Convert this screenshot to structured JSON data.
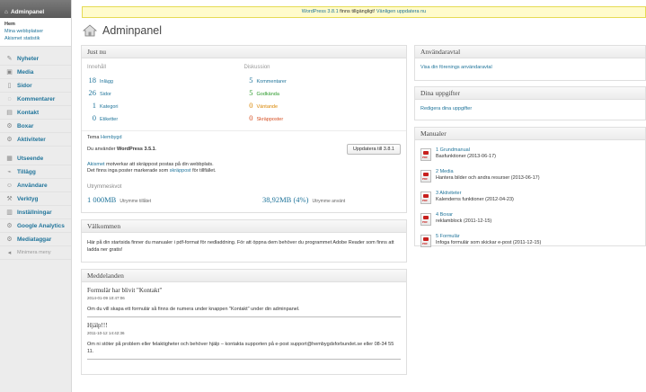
{
  "sidebar": {
    "top_label": "Adminpanel",
    "sub": [
      {
        "label": "Hem"
      },
      {
        "label": "Mina webbplatser"
      },
      {
        "label": "Akismet statistik"
      }
    ],
    "items": [
      {
        "label": "Nyheter",
        "icon": "pin-icon"
      },
      {
        "label": "Media",
        "icon": "media-icon"
      },
      {
        "label": "Sidor",
        "icon": "pages-icon"
      },
      {
        "label": "Kommentarer",
        "icon": "comment-icon"
      },
      {
        "label": "Kontakt",
        "icon": "contact-icon"
      },
      {
        "label": "Boxar",
        "icon": "box-icon"
      },
      {
        "label": "Aktiviteter",
        "icon": "gear-icon"
      },
      {
        "label": "Utseende",
        "icon": "appearance-icon"
      },
      {
        "label": "Tillägg",
        "icon": "plugin-icon"
      },
      {
        "label": "Användare",
        "icon": "user-icon"
      },
      {
        "label": "Verktyg",
        "icon": "tools-icon"
      },
      {
        "label": "Inställningar",
        "icon": "settings-icon"
      },
      {
        "label": "Google Analytics",
        "icon": "analytics-icon"
      },
      {
        "label": "Mediataggar",
        "icon": "tag-icon"
      }
    ],
    "collapse_label": "Minimera meny"
  },
  "notice": {
    "prefix": "WordPress 3.8.1",
    "middle": " finns tillgängligt! ",
    "link": "Vänligen uppdatera nu"
  },
  "page": {
    "title": "Adminpanel"
  },
  "just_nu": {
    "title": "Just nu",
    "content_header": "Innehåll",
    "discussion_header": "Diskussion",
    "content": [
      {
        "num": "18",
        "label": "Inlägg"
      },
      {
        "num": "26",
        "label": "Sidor"
      },
      {
        "num": "1",
        "label": "Kategori"
      },
      {
        "num": "0",
        "label": "Etiketter"
      }
    ],
    "discussion": [
      {
        "num": "5",
        "label": "Kommentarer"
      },
      {
        "num": "5",
        "label": "Godkända"
      },
      {
        "num": "0",
        "label": "Väntande"
      },
      {
        "num": "0",
        "label": "Skräpposter"
      }
    ],
    "theme_prefix": "Tema ",
    "theme_name": "Hembygd",
    "version_prefix": "Du använder ",
    "version_name": "WordPress 3.5.1",
    "version_suffix": ".",
    "update_button": "Uppdatera till 3.8.1",
    "akismet_link": "Akismet",
    "akismet_text1": " motverkar att skräppost postas på din webbplats.",
    "akismet_text2": "Det finns inga poster markerade som ",
    "akismet_spam_link": "skräppost",
    "akismet_text3": " för tillfället.",
    "storage_title": "Utrymmeskvot",
    "storage_allowed_num": "1 000MB",
    "storage_allowed_label": "Utrymme tillåtet",
    "storage_used_num": "38,92MB (4%)",
    "storage_used_label": "Utrymme använt"
  },
  "valkommen": {
    "title": "Välkommen",
    "text": "Här på din startsida finner du manualer i pdf-format för nedladdning. För att öppna dem behöver du programmet Adobe Reader som finns att ladda ner gratis!"
  },
  "meddelanden": {
    "title": "Meddelanden",
    "messages": [
      {
        "title": "Formulär har blivit \"Kontakt\"",
        "date": "2014-01-09 10:47:06",
        "text": "Om du vill skapa ett formulär så finns de numera under knappen \"Kontakt\" under din adminpanel."
      },
      {
        "title": "Hjälp!!!",
        "date": "2011-10-12 14:42:36",
        "text": "Om ni stöter på problem eller felaktigheter och behöver hjälp – kontakta supporten på e-post support@hembygdsforbundet.se eller 08-34 55 11."
      }
    ]
  },
  "anvandaravtal": {
    "title": "Användaravtal",
    "link": "Visa din förenings användaravtal"
  },
  "uppgifter": {
    "title": "Dina uppgifter",
    "link": "Redigera dina uppgifter"
  },
  "manualer": {
    "title": "Manualer",
    "items": [
      {
        "name": "1 Grundmanual",
        "desc": "Basfunktioner (2013-06-17)"
      },
      {
        "name": "2 Media",
        "desc": "Hantera bilder och andra resurser (2013-06-17)"
      },
      {
        "name": "3 Aktiviteter",
        "desc": "Kalenderns funktioner (2012-04-23)"
      },
      {
        "name": "4 Boxar",
        "desc": "reklamblock (2011-12-15)"
      },
      {
        "name": "5 Formulär",
        "desc": "Infoga formulär som skickar e-post (2011-12-15)"
      }
    ]
  }
}
